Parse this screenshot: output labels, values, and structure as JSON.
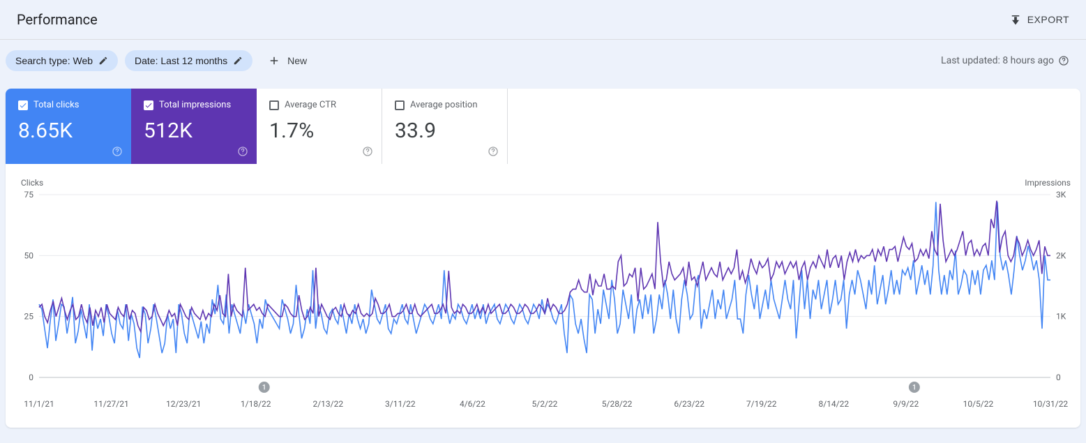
{
  "header": {
    "title": "Performance",
    "export_label": "EXPORT"
  },
  "filters": {
    "search_type_label": "Search type: Web",
    "date_label": "Date: Last 12 months",
    "new_label": "New",
    "last_updated": "Last updated: 8 hours ago"
  },
  "metrics": {
    "total_clicks": {
      "label": "Total clicks",
      "value": "8.65K"
    },
    "total_impressions": {
      "label": "Total impressions",
      "value": "512K"
    },
    "avg_ctr": {
      "label": "Average CTR",
      "value": "1.7%"
    },
    "avg_position": {
      "label": "Average position",
      "value": "33.9"
    }
  },
  "chart_data": {
    "type": "line",
    "title": "",
    "y_left_label": "Clicks",
    "y_right_label": "Impressions",
    "y_left_ticks": [
      0,
      25,
      50,
      75
    ],
    "y_right_ticks": [
      "0",
      "1K",
      "2K",
      "3K"
    ],
    "ylim_left": [
      0,
      75
    ],
    "ylim_right": [
      0,
      3000
    ],
    "x_ticks": [
      "11/1/21",
      "11/27/21",
      "12/23/21",
      "1/18/22",
      "2/13/22",
      "3/11/22",
      "4/6/22",
      "5/2/22",
      "5/28/22",
      "6/23/22",
      "7/19/22",
      "8/14/22",
      "9/9/22",
      "10/5/22",
      "10/31/22"
    ],
    "markers": [
      {
        "x_tick": "1/18/22",
        "label": "1"
      },
      {
        "x_tick": "9/9/22",
        "label": "1"
      }
    ],
    "series": [
      {
        "name": "Clicks",
        "color": "#4285f4",
        "axis": "left",
        "values": [
          30,
          28,
          20,
          12,
          23,
          32,
          15,
          22,
          30,
          29,
          18,
          25,
          33,
          14,
          19,
          28,
          22,
          16,
          30,
          11,
          26,
          20,
          24,
          17,
          30,
          25,
          18,
          14,
          28,
          22,
          20,
          30,
          15,
          26,
          22,
          12,
          8,
          29,
          26,
          14,
          20,
          30,
          24,
          17,
          10,
          14,
          26,
          20,
          24,
          10,
          30,
          26,
          18,
          14,
          28,
          24,
          20,
          16,
          23,
          14,
          22,
          18,
          32,
          26,
          38,
          24,
          22,
          34,
          18,
          30,
          26,
          22,
          18,
          28,
          22,
          30,
          26,
          22,
          14,
          24,
          20,
          32,
          28,
          26,
          24,
          22,
          20,
          32,
          28,
          24,
          18,
          22,
          38,
          26,
          16,
          20,
          28,
          22,
          44,
          20,
          30,
          26,
          20,
          18,
          26,
          28,
          24,
          22,
          30,
          24,
          18,
          26,
          22,
          30,
          24,
          20,
          24,
          18,
          22,
          36,
          30,
          24,
          22,
          26,
          30,
          20,
          18,
          24,
          22,
          26,
          30,
          24,
          22,
          30,
          24,
          18,
          22,
          26,
          30,
          28,
          24,
          22,
          26,
          30,
          24,
          44,
          28,
          22,
          26,
          24,
          30,
          28,
          24,
          22,
          26,
          30,
          24,
          28,
          24,
          30,
          22,
          26,
          28,
          30,
          24,
          22,
          26,
          30,
          28,
          24,
          22,
          26,
          30,
          28,
          24,
          22,
          26,
          30,
          28,
          24,
          32,
          26,
          30,
          28,
          24,
          22,
          26,
          30,
          18,
          10,
          34,
          32,
          22,
          18,
          24,
          16,
          10,
          34,
          32,
          18,
          28,
          22,
          36,
          30,
          24,
          40,
          32,
          18,
          22,
          36,
          30,
          24,
          34,
          18,
          28,
          32,
          24,
          34,
          26,
          34,
          18,
          24,
          34,
          28,
          40,
          34,
          24,
          36,
          24,
          18,
          32,
          40,
          34,
          24,
          26,
          38,
          42,
          20,
          28,
          24,
          30,
          36,
          24,
          32,
          28,
          36,
          24,
          28,
          32,
          40,
          24,
          24,
          18,
          34,
          42,
          34,
          28,
          38,
          24,
          30,
          36,
          28,
          40,
          32,
          28,
          24,
          32,
          40,
          32,
          28,
          40,
          16,
          30,
          44,
          28,
          40,
          24,
          36,
          32,
          40,
          28,
          34,
          40,
          26,
          32,
          40,
          30,
          32,
          40,
          20,
          34,
          40,
          34,
          44,
          40,
          34,
          28,
          40,
          34,
          46,
          30,
          36,
          42,
          30,
          36,
          44,
          34,
          40,
          34,
          44,
          42,
          45,
          40,
          48,
          34,
          40,
          46,
          38,
          44,
          34,
          46,
          72,
          44,
          34,
          42,
          34,
          44,
          40,
          52,
          34,
          38,
          44,
          42,
          34,
          44,
          38,
          44,
          34,
          44,
          46,
          40,
          48,
          40,
          72,
          50,
          44,
          48,
          42,
          34,
          44,
          58,
          50,
          44,
          48,
          54,
          50,
          44,
          48,
          40,
          20,
          50,
          40,
          40
        ]
      },
      {
        "name": "Impressions",
        "color": "#5e35b1",
        "axis": "right",
        "values": [
          1150,
          1200,
          1000,
          900,
          1100,
          1250,
          1000,
          1150,
          1300,
          1100,
          950,
          1100,
          1200,
          950,
          1000,
          1200,
          1000,
          900,
          1150,
          850,
          1100,
          1000,
          1150,
          900,
          1200,
          1050,
          1000,
          950,
          1150,
          1050,
          1000,
          1200,
          950,
          1100,
          1050,
          850,
          750,
          1150,
          1100,
          950,
          1000,
          1200,
          1050,
          950,
          850,
          950,
          1100,
          1000,
          1050,
          850,
          1200,
          1100,
          1000,
          950,
          1150,
          1050,
          1000,
          950,
          1100,
          950,
          1050,
          1000,
          1200,
          1100,
          1350,
          1050,
          1000,
          1700,
          1000,
          1200,
          1100,
          1050,
          1000,
          1800,
          1100,
          1150,
          1200,
          1100,
          1150,
          1050,
          1000,
          1200,
          1150,
          1100,
          1050,
          1000,
          1000,
          1200,
          1150,
          1050,
          1000,
          1000,
          1350,
          1100,
          950,
          1000,
          1150,
          1050,
          1800,
          1000,
          1200,
          1100,
          1000,
          950,
          1100,
          1150,
          1050,
          1000,
          1200,
          1050,
          1000,
          1100,
          1050,
          1200,
          1050,
          1000,
          1050,
          1000,
          1050,
          1300,
          1200,
          1050,
          1050,
          1100,
          1200,
          1000,
          1000,
          1050,
          1050,
          1100,
          1200,
          1050,
          1050,
          1200,
          1050,
          1000,
          1050,
          1100,
          1150,
          1200,
          1050,
          1050,
          1100,
          1200,
          1050,
          1750,
          1150,
          1050,
          1100,
          1050,
          1200,
          1150,
          1050,
          1050,
          1100,
          1200,
          1050,
          1150,
          1050,
          1200,
          1050,
          1100,
          1150,
          1200,
          1050,
          1050,
          1100,
          1200,
          1150,
          1050,
          1050,
          1100,
          1200,
          1150,
          1050,
          1050,
          1100,
          1200,
          1150,
          1050,
          1300,
          1100,
          1200,
          1150,
          1050,
          1050,
          1100,
          1200,
          1400,
          1450,
          1450,
          1600,
          1450,
          1400,
          1400,
          1700,
          1350,
          1600,
          1500,
          1500,
          1700,
          1450,
          1450,
          1500,
          1450,
          1900,
          2000,
          1500,
          1550,
          1700,
          1650,
          1800,
          1250,
          1800,
          1450,
          1500,
          1600,
          1700,
          1450,
          2550,
          1900,
          1500,
          1600,
          1900,
          1700,
          1600,
          1650,
          1700,
          1800,
          1500,
          1900,
          1600,
          1650,
          1500,
          1700,
          1900,
          1600,
          1700,
          1800,
          1700,
          1650,
          1900,
          1600,
          1700,
          1800,
          1700,
          1800,
          2100,
          1600,
          1750,
          1550,
          1700,
          1950,
          1800,
          1700,
          1900,
          1800,
          1850,
          1950,
          1600,
          1700,
          1900,
          1800,
          1900,
          1700,
          1800,
          1900,
          1800,
          1900,
          1600,
          1800,
          1900,
          1600,
          1800,
          1900,
          1800,
          2000,
          1900,
          1800,
          2100,
          1800,
          1950,
          2000,
          1800,
          2000,
          1600,
          1900,
          2050,
          1900,
          2100,
          1900,
          2000,
          1950,
          2000,
          2000,
          2100,
          1900,
          2100,
          2000,
          2150,
          1900,
          2100,
          2100,
          2150,
          1900,
          2100,
          2300,
          2150,
          2100,
          2200,
          1900,
          1950,
          2100,
          2000,
          2100,
          1950,
          2400,
          2100,
          2000,
          2850,
          2250,
          1900,
          2000,
          2100,
          2000,
          2100,
          2250,
          2400,
          2000,
          2200,
          2250,
          2000,
          2100,
          2000,
          2150,
          2200,
          2000,
          2600,
          2450,
          2900,
          2050,
          2300,
          2400,
          2000,
          1900,
          2000,
          2300,
          2200,
          2000,
          2100,
          2250,
          2100,
          2000,
          2100,
          2250,
          1700,
          2150,
          2000,
          2000
        ]
      }
    ]
  }
}
